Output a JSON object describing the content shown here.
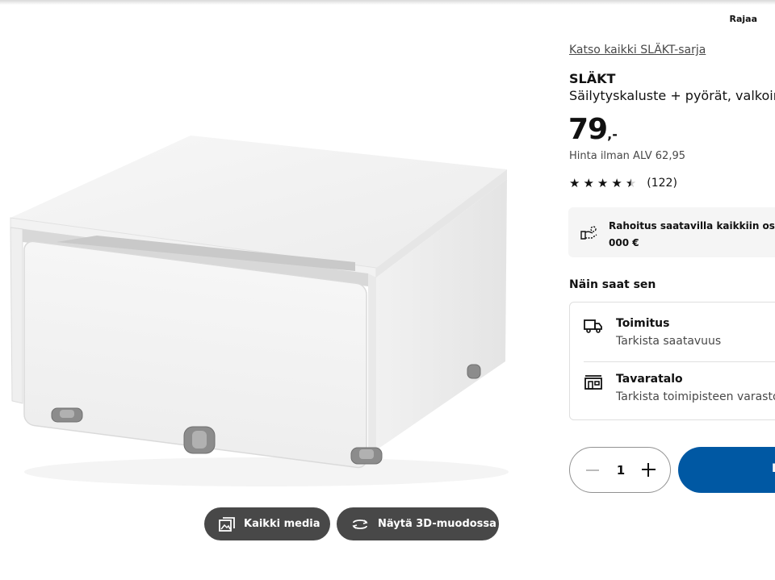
{
  "header": {
    "filter_label": "Rajaa"
  },
  "media": {
    "all_media_label": "Kaikki media",
    "view_3d_label": "Näytä 3D-muodossa"
  },
  "product": {
    "series_link": "Katso kaikki SLÄKT-sarja",
    "name": "SLÄKT",
    "description": "Säilytyskaluste + pyörät, valkoinen",
    "price_integer": "79",
    "price_decimal": ",-",
    "price_excl_vat": "Hinta ilman ALV 62,95",
    "rating": {
      "stars": 4.5,
      "max": 5,
      "count": "(122)"
    }
  },
  "financing": {
    "line1": "Rahoitus saatavilla kaikkiin ostok",
    "line2": "000 €"
  },
  "delivery": {
    "section_title": "Näin saat sen",
    "options": [
      {
        "icon": "truck-icon",
        "title": "Toimitus",
        "subtitle": "Tarkista saatavuus"
      },
      {
        "icon": "store-icon",
        "title": "Tavaratalo",
        "subtitle": "Tarkista toimipisteen varastos"
      }
    ]
  },
  "purchase": {
    "quantity": "1",
    "buy_label": "L"
  },
  "colors": {
    "accent": "#0058a3",
    "media_button": "#484848",
    "secondary_text": "#484848"
  }
}
